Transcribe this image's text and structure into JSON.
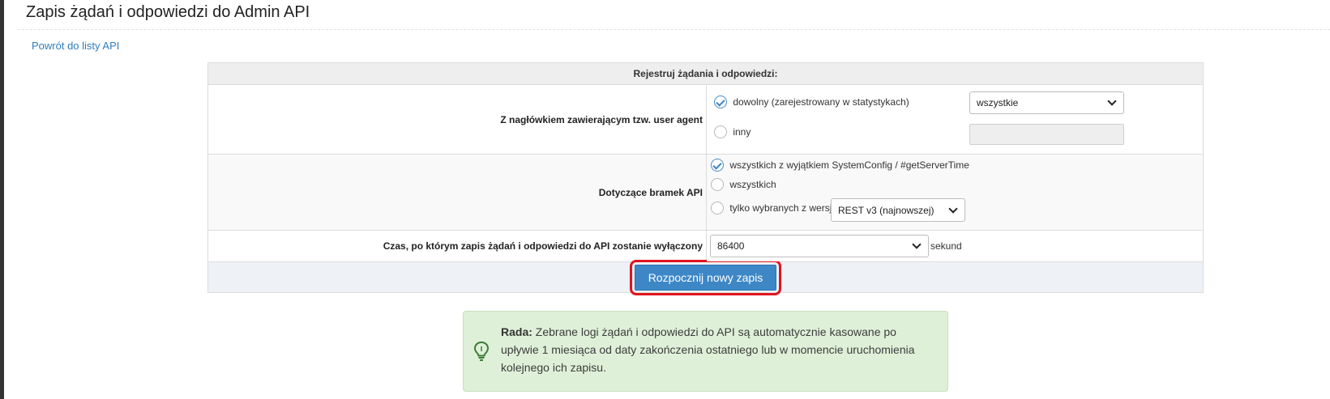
{
  "page": {
    "title": "Zapis żądań i odpowiedzi do Admin API",
    "back_link": "Powrót do listy API"
  },
  "form": {
    "header": "Rejestruj żądania i odpowiedzi:",
    "user_agent": {
      "label": "Z nagłówkiem zawierającym tzw. user agent",
      "option_any": "dowolny (zarejestrowany w statystykach)",
      "option_any_checked": true,
      "select_value": "wszystkie",
      "option_other": "inny",
      "other_input_value": ""
    },
    "gateways": {
      "label": "Dotyczące bramek API",
      "option_all_except": "wszystkich z wyjątkiem SystemConfig / #getServerTime",
      "option_all_except_checked": true,
      "option_all": "wszystkich",
      "option_selected_version": "tylko wybranych z wersji",
      "version_select_value": "REST v3 (najnowszej)"
    },
    "duration": {
      "label": "Czas, po którym zapis żądań i odpowiedzi do API zostanie wyłączony",
      "select_value": "86400",
      "unit": "sekund"
    },
    "submit_label": "Rozpocznij nowy zapis"
  },
  "tip": {
    "title": "Rada:",
    "text": " Zebrane logi żądań i odpowiedzi do API są automatycznie kasowane po upływie 1 miesiąca od daty zakończenia ostatniego lub w momencie uruchomienia kolejnego ich zapisu.",
    "icon": "lightbulb-icon"
  },
  "colors": {
    "accent": "#3d87c7",
    "link": "#2f7dbb",
    "highlight": "#e0141e",
    "tip_background": "#dff0d8"
  }
}
